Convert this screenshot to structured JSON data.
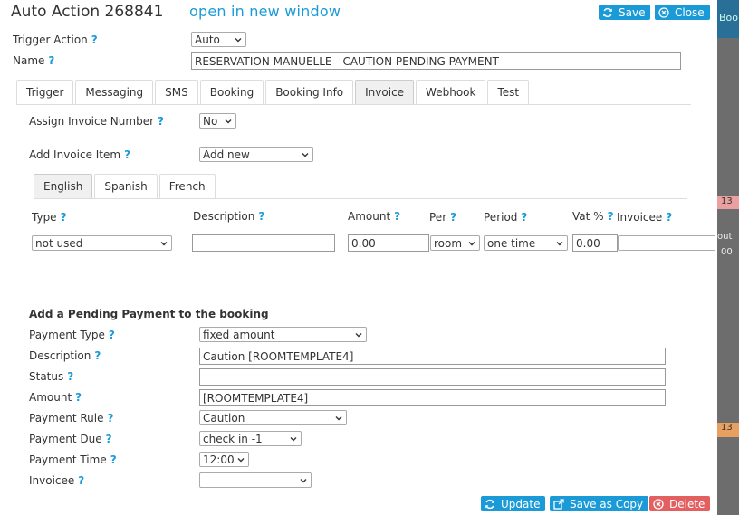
{
  "header": {
    "title": "Auto Action 268841",
    "open_link": "open in new window",
    "save": "Save",
    "close": "Close"
  },
  "trigger_action": {
    "label": "Trigger Action",
    "value": "Auto"
  },
  "name": {
    "label": "Name",
    "value": "RESERVATION MANUELLE - CAUTION PENDING PAYMENT"
  },
  "tabs": [
    "Trigger",
    "Messaging",
    "SMS",
    "Booking",
    "Booking Info",
    "Invoice",
    "Webhook",
    "Test"
  ],
  "active_tab": "Invoice",
  "assign_invoice": {
    "label": "Assign Invoice Number",
    "value": "No"
  },
  "add_item": {
    "label": "Add Invoice Item",
    "value": "Add new"
  },
  "lang_tabs": [
    "English",
    "Spanish",
    "French"
  ],
  "active_lang": "English",
  "item_cols": {
    "type": "Type",
    "description": "Description",
    "amount": "Amount",
    "per": "Per",
    "period": "Period",
    "vat": "Vat %",
    "invoicee": "Invoicee"
  },
  "item_row": {
    "type": "not used",
    "description": "",
    "amount": "0.00",
    "per": "room",
    "period": "one time",
    "vat": "0.00",
    "invoicee": ""
  },
  "pending": {
    "heading": "Add a Pending Payment to the booking",
    "payment_type": {
      "label": "Payment Type",
      "value": "fixed amount"
    },
    "description": {
      "label": "Description",
      "value": "Caution [ROOMTEMPLATE4]"
    },
    "status": {
      "label": "Status",
      "value": ""
    },
    "amount": {
      "label": "Amount",
      "value": "[ROOMTEMPLATE4]"
    },
    "payment_rule": {
      "label": "Payment Rule",
      "value": "Caution"
    },
    "payment_due": {
      "label": "Payment Due",
      "value": "check in -1"
    },
    "payment_time": {
      "label": "Payment Time",
      "value": "12:00"
    },
    "invoicee": {
      "label": "Invoicee",
      "value": ""
    }
  },
  "footer": {
    "update": "Update",
    "save_copy": "Save as Copy",
    "delete": "Delete"
  },
  "help_mark": "?",
  "background": {
    "top_text": "Book",
    "c1": "13",
    "c2": "out",
    "c3": "00",
    "c4": "13"
  },
  "colors": {
    "accent": "#1a9bd7",
    "danger": "#e36060"
  }
}
